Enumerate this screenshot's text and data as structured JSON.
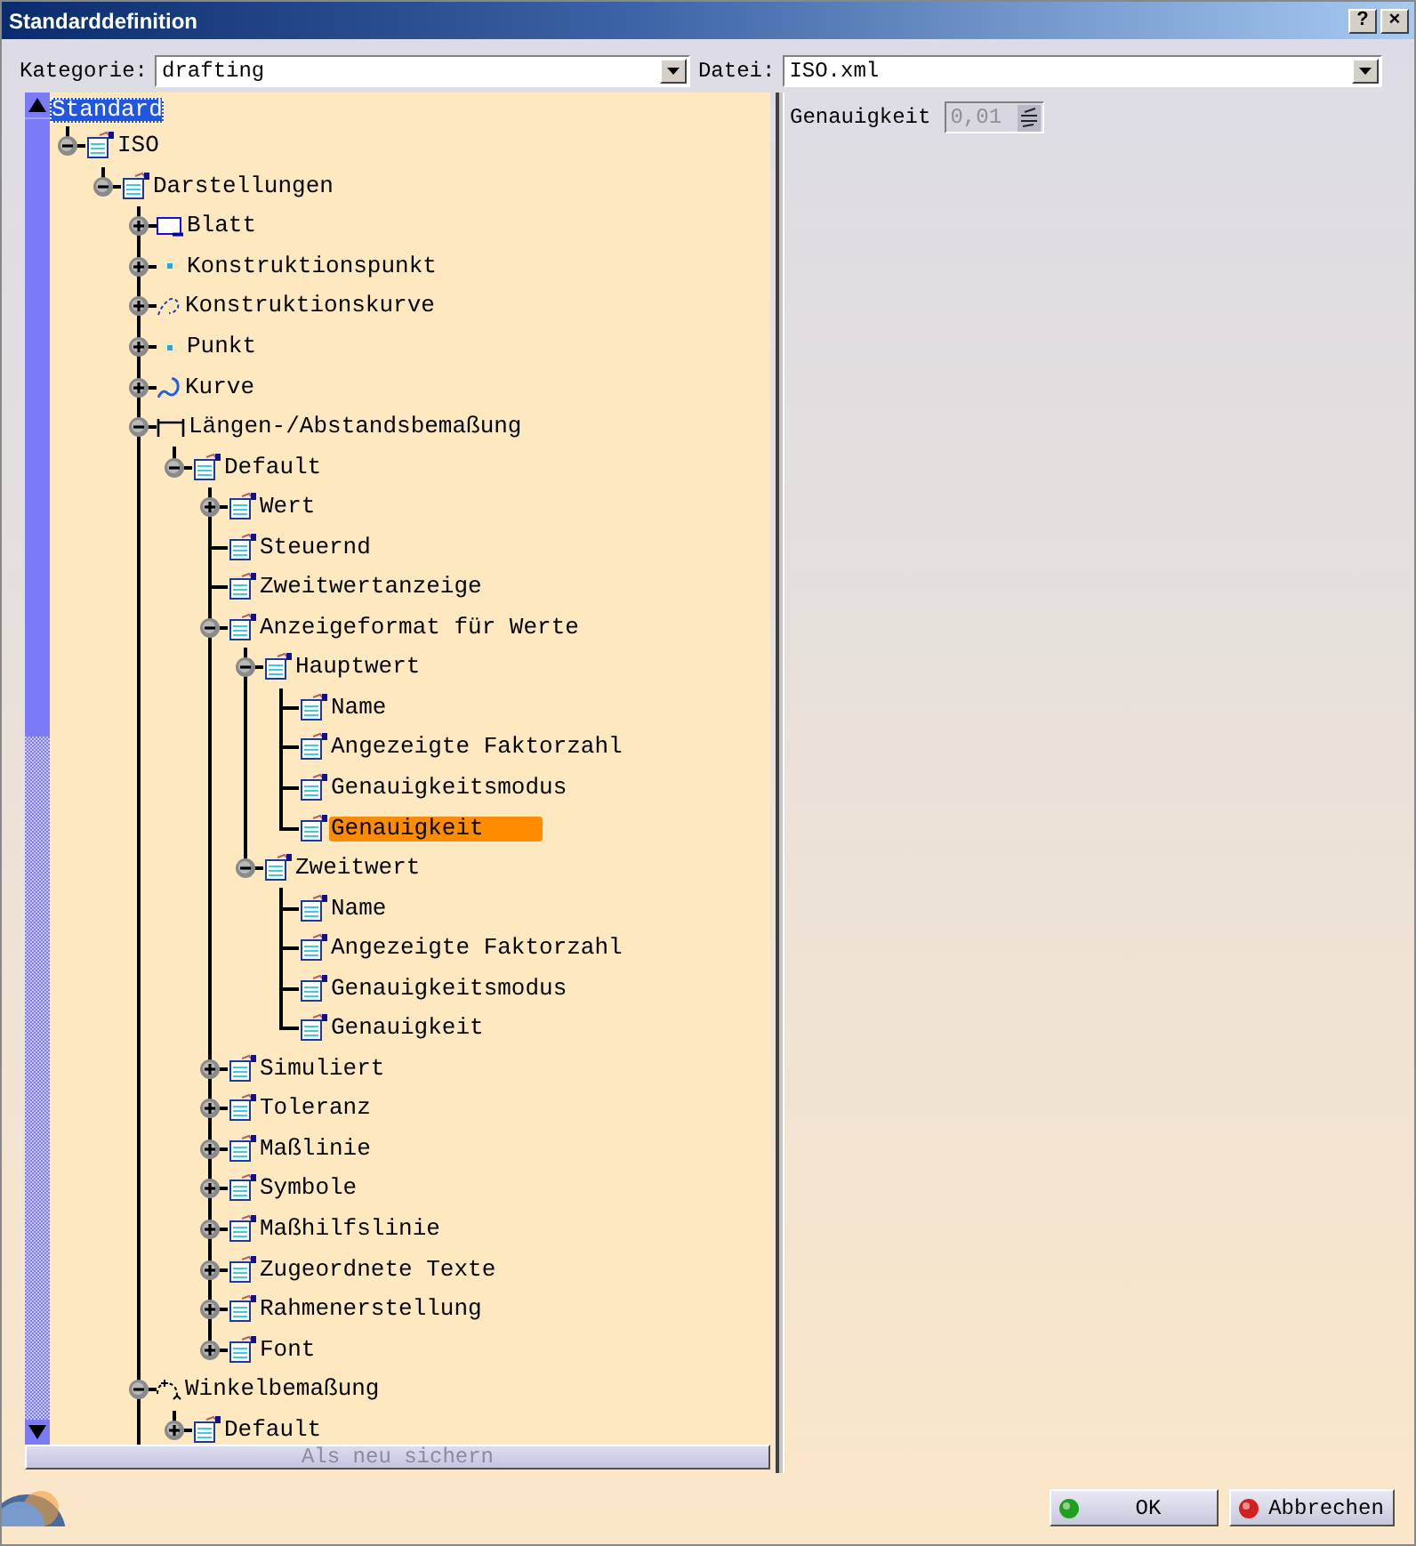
{
  "window": {
    "title": "Standarddefinition",
    "help_button": "?",
    "close_button": "×"
  },
  "category": {
    "label": "Kategorie:",
    "value": "drafting"
  },
  "file": {
    "label": "Datei:",
    "value": "ISO.xml"
  },
  "tree": {
    "label": "Standard",
    "focused": true,
    "children": [
      {
        "label": "ISO",
        "kind": "doc",
        "expanded": true,
        "selected": false,
        "children": [
          {
            "label": "Darstellungen",
            "kind": "doc",
            "expanded": true,
            "selected": false,
            "cut_off": true,
            "children": [
              {
                "label": "Blatt",
                "kind": "sheet",
                "expanded": false,
                "selected": false
              },
              {
                "label": "Konstruktionspunkt",
                "kind": "point",
                "expanded": false,
                "selected": false
              },
              {
                "label": "Konstruktionskurve",
                "kind": "dashed-curve",
                "expanded": false,
                "selected": false
              },
              {
                "label": "Punkt",
                "kind": "point",
                "expanded": false,
                "selected": false
              },
              {
                "label": "Kurve",
                "kind": "curve",
                "expanded": false,
                "selected": false
              },
              {
                "label": "Längen-/Abstandsbemaßung",
                "kind": "dimension",
                "expanded": true,
                "selected": false,
                "children": [
                  {
                    "label": "Default",
                    "kind": "doc",
                    "expanded": true,
                    "selected": false,
                    "children": [
                      {
                        "label": "Wert",
                        "kind": "doc",
                        "expanded": false,
                        "selected": false
                      },
                      {
                        "label": "Steuernd",
                        "kind": "doc",
                        "selected": false
                      },
                      {
                        "label": "Zweitwertanzeige",
                        "kind": "doc",
                        "selected": false
                      },
                      {
                        "label": "Anzeigeformat für Werte",
                        "kind": "doc",
                        "expanded": true,
                        "selected": false,
                        "children": [
                          {
                            "label": "Hauptwert",
                            "kind": "doc",
                            "expanded": true,
                            "selected": false,
                            "children": [
                              {
                                "label": "Name",
                                "kind": "doc",
                                "selected": false
                              },
                              {
                                "label": "Angezeigte Faktorzahl",
                                "kind": "doc",
                                "selected": false
                              },
                              {
                                "label": "Genauigkeitsmodus",
                                "kind": "doc",
                                "selected": false
                              },
                              {
                                "label": "Genauigkeit",
                                "kind": "doc",
                                "selected": true
                              }
                            ]
                          },
                          {
                            "label": "Zweitwert",
                            "kind": "doc",
                            "expanded": true,
                            "selected": false,
                            "children": [
                              {
                                "label": "Name",
                                "kind": "doc",
                                "selected": false
                              },
                              {
                                "label": "Angezeigte Faktorzahl",
                                "kind": "doc",
                                "selected": false
                              },
                              {
                                "label": "Genauigkeitsmodus",
                                "kind": "doc",
                                "selected": false
                              },
                              {
                                "label": "Genauigkeit",
                                "kind": "doc",
                                "selected": false
                              }
                            ]
                          }
                        ]
                      },
                      {
                        "label": "Simuliert",
                        "kind": "doc",
                        "expanded": false,
                        "selected": false
                      },
                      {
                        "label": "Toleranz",
                        "kind": "doc",
                        "expanded": false,
                        "selected": false
                      },
                      {
                        "label": "Maßlinie",
                        "kind": "doc",
                        "expanded": false,
                        "selected": false
                      },
                      {
                        "label": "Symbole",
                        "kind": "doc",
                        "expanded": false,
                        "selected": false
                      },
                      {
                        "label": "Maßhilfslinie",
                        "kind": "doc",
                        "expanded": false,
                        "selected": false
                      },
                      {
                        "label": "Zugeordnete Texte",
                        "kind": "doc",
                        "expanded": false,
                        "selected": false
                      },
                      {
                        "label": "Rahmenerstellung",
                        "kind": "doc",
                        "expanded": false,
                        "selected": false
                      },
                      {
                        "label": "Font",
                        "kind": "doc",
                        "expanded": false,
                        "selected": false
                      }
                    ]
                  }
                ]
              },
              {
                "label": "Winkelbemaßung",
                "kind": "angle",
                "expanded": true,
                "selected": false,
                "children": [
                  {
                    "label": "Default",
                    "kind": "doc",
                    "expanded": false,
                    "selected": false
                  }
                ]
              }
            ]
          }
        ]
      }
    ]
  },
  "save_as_new_button": {
    "label": "Als neu sichern",
    "disabled": true
  },
  "properties": [
    {
      "label": "Genauigkeit",
      "value": "0,01",
      "disabled": true
    }
  ],
  "buttons": [
    {
      "label": "OK",
      "kind": "ok"
    },
    {
      "label": "Abbrechen",
      "kind": "cancel"
    }
  ]
}
